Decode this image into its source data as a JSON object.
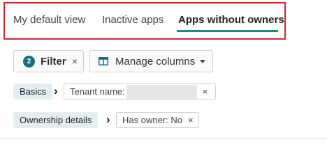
{
  "tabs": [
    {
      "label": "My default view"
    },
    {
      "label": "Inactive apps"
    },
    {
      "label": "Apps without owners",
      "active": true
    }
  ],
  "toolbar": {
    "filter_count": "2",
    "filter_label": "Filter",
    "filter_clear": "×",
    "columns_label": "Manage columns"
  },
  "filters": [
    {
      "category": "Basics",
      "value": "Tenant name:",
      "value_redacted": true,
      "remove": "×"
    },
    {
      "category": "Ownership details",
      "value": "Has owner: No",
      "remove": "×"
    }
  ],
  "colors": {
    "accent": "#1a8a8d",
    "highlight_border": "#d0282e",
    "badge": "#1a6f83"
  }
}
